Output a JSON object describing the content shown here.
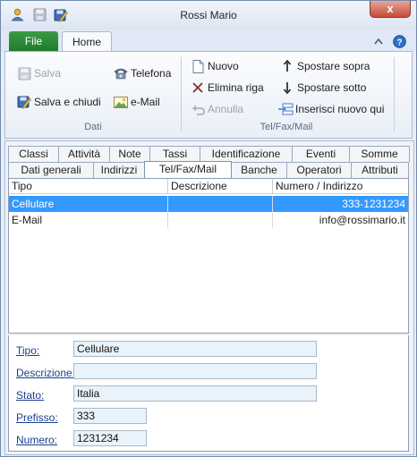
{
  "window": {
    "title": "Rossi Mario",
    "close_glyph": "x"
  },
  "quick_access": {
    "icons": [
      "user-icon",
      "save-icon",
      "save-edit-icon"
    ]
  },
  "ribbon_tabs": {
    "file": "File",
    "home": "Home",
    "minimize_glyph": "^",
    "help_glyph": "?"
  },
  "ribbon": {
    "dati": {
      "salva": "Salva",
      "salva_e_chiudi": "Salva e chiudi",
      "telefona": "Telefona",
      "email": "e-Mail",
      "label": "Dati"
    },
    "telfaxmail": {
      "nuovo": "Nuovo",
      "elimina_riga": "Elimina riga",
      "annulla": "Annulla",
      "spostare_sopra": "Spostare sopra",
      "spostare_sotto": "Spostare sotto",
      "inserisci_nuovo_qui": "Inserisci nuovo qui",
      "label": "Tel/Fax/Mail"
    }
  },
  "tabs": {
    "row1": [
      "Classi",
      "Attività",
      "Note",
      "Tassi",
      "Identificazione",
      "Eventi",
      "Somme"
    ],
    "row2": [
      "Dati generali",
      "Indirizzi",
      "Tel/Fax/Mail",
      "Banche",
      "Operatori",
      "Attributi"
    ],
    "active": "Tel/Fax/Mail"
  },
  "grid": {
    "headers": [
      "Tipo",
      "Descrizione",
      "Numero / Indirizzo"
    ],
    "rows": [
      {
        "tipo": "Cellulare",
        "descrizione": "",
        "numero": "333-1231234",
        "selected": true
      },
      {
        "tipo": "E-Mail",
        "descrizione": "",
        "numero": "info@rossimario.it",
        "selected": false
      }
    ]
  },
  "form": {
    "tipo": {
      "label": "Tipo:",
      "value": "Cellulare"
    },
    "descrizione": {
      "label": "Descrizione:",
      "value": ""
    },
    "stato": {
      "label": "Stato:",
      "value": "Italia"
    },
    "prefisso": {
      "label": "Prefisso:",
      "value": "333"
    },
    "numero": {
      "label": "Numero:",
      "value": "1231234"
    }
  },
  "colors": {
    "file_tab": "#2a8a36",
    "selection": "#3399ff",
    "label_blue": "#1a3f8f",
    "close_button": "#c74a36"
  }
}
